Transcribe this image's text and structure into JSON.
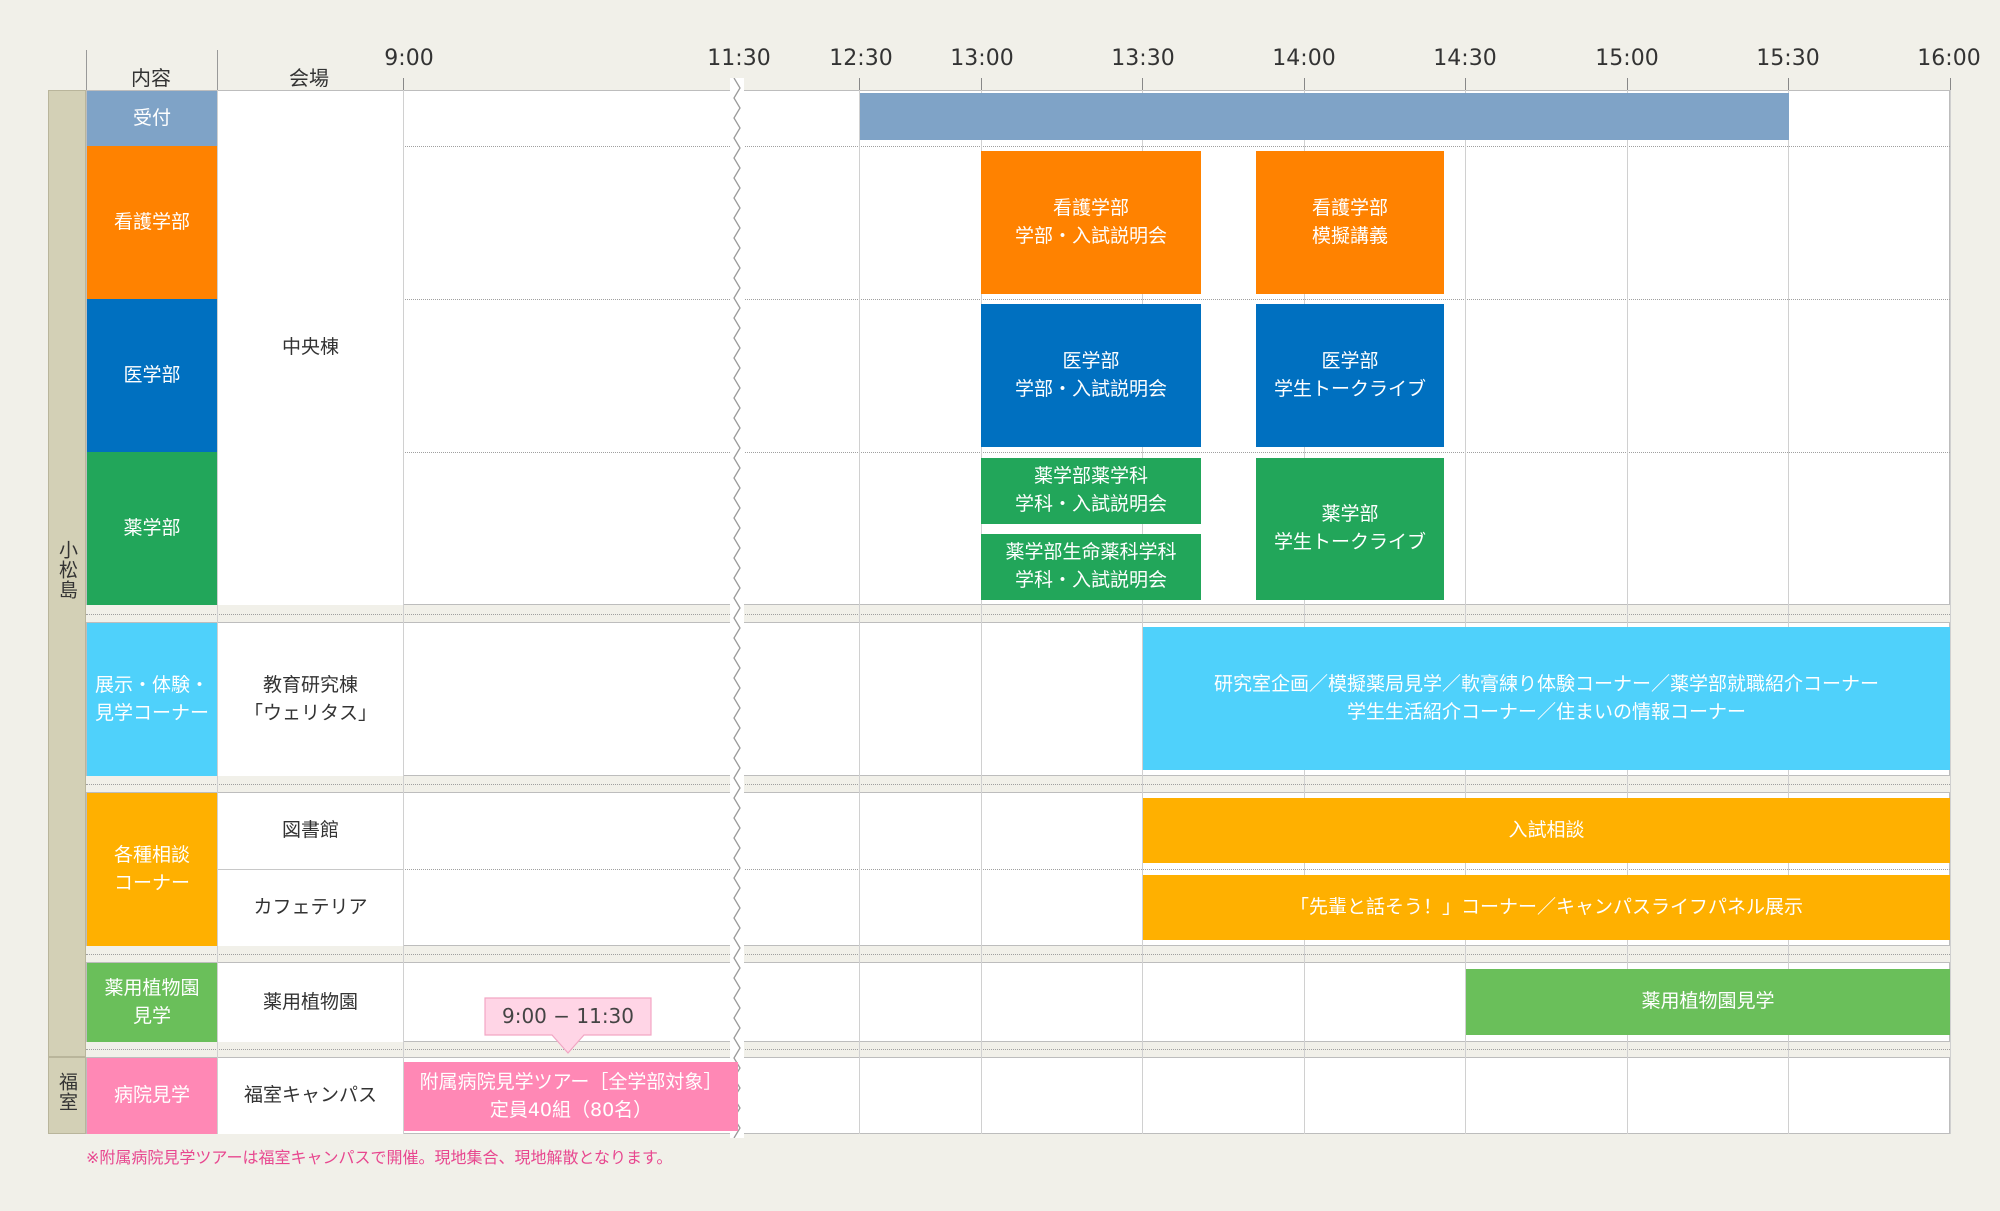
{
  "header": {
    "col_content": "内容",
    "col_venue": "会場",
    "times": [
      "9:00",
      "11:30",
      "12:30",
      "13:00",
      "13:30",
      "14:00",
      "14:30",
      "15:00",
      "15:30",
      "16:00"
    ]
  },
  "campuses": {
    "komatsushima": "小松島",
    "fukumuro": "福室"
  },
  "categories": {
    "reception": "受付",
    "nursing": "看護学部",
    "medicine": "医学部",
    "pharmacy": "薬学部",
    "exhibit": "展示・体験・\n見学コーナー",
    "consult": "各種相談\nコーナー",
    "garden": "薬用植物園\n見学",
    "hospital": "病院見学"
  },
  "venues": {
    "central": "中央棟",
    "veritas": "教育研究棟\n「ウェリタス」",
    "library": "図書館",
    "cafeteria": "カフェテリア",
    "garden": "薬用植物園",
    "fukumuro": "福室キャンパス"
  },
  "events": {
    "nursing_briefing": "看護学部\n学部・入試説明会",
    "nursing_lecture": "看護学部\n模擬講義",
    "medicine_briefing": "医学部\n学部・入試説明会",
    "medicine_live": "医学部\n学生トークライブ",
    "pharm_sci_briefing": "薬学部薬学科\n学科・入試説明会",
    "pharm_life_briefing": "薬学部生命薬科学科\n学科・入試説明会",
    "pharm_live": "薬学部\n学生トークライブ",
    "exhibit": "研究室企画／模擬薬局見学／軟膏練り体験コーナー／薬学部就職紹介コーナー\n学生生活紹介コーナー／住まいの情報コーナー",
    "admission_consult": "入試相談",
    "senpai_corner": "「先輩と話そう！」コーナー／キャンパスライフパネル展示",
    "garden_tour": "薬用植物園見学",
    "hospital_tour": "附属病院見学ツアー［全学部対象］\n定員40組（80名）"
  },
  "callout": "9:00 − 11:30",
  "footnote": "※附属病院見学ツアーは福室キャンパスで開催。現地集合、現地解散となります。",
  "colors": {
    "reception": "#7fa3c7",
    "nursing": "#ff8200",
    "medicine": "#0070c0",
    "pharmacy": "#22a65a",
    "exhibit": "#4fd1fb",
    "consult": "#ffb000",
    "garden": "#6abf5a",
    "hospital": "#ff88b5",
    "campus_band": "#d3d0b6",
    "callout": "#ffd5e6"
  }
}
